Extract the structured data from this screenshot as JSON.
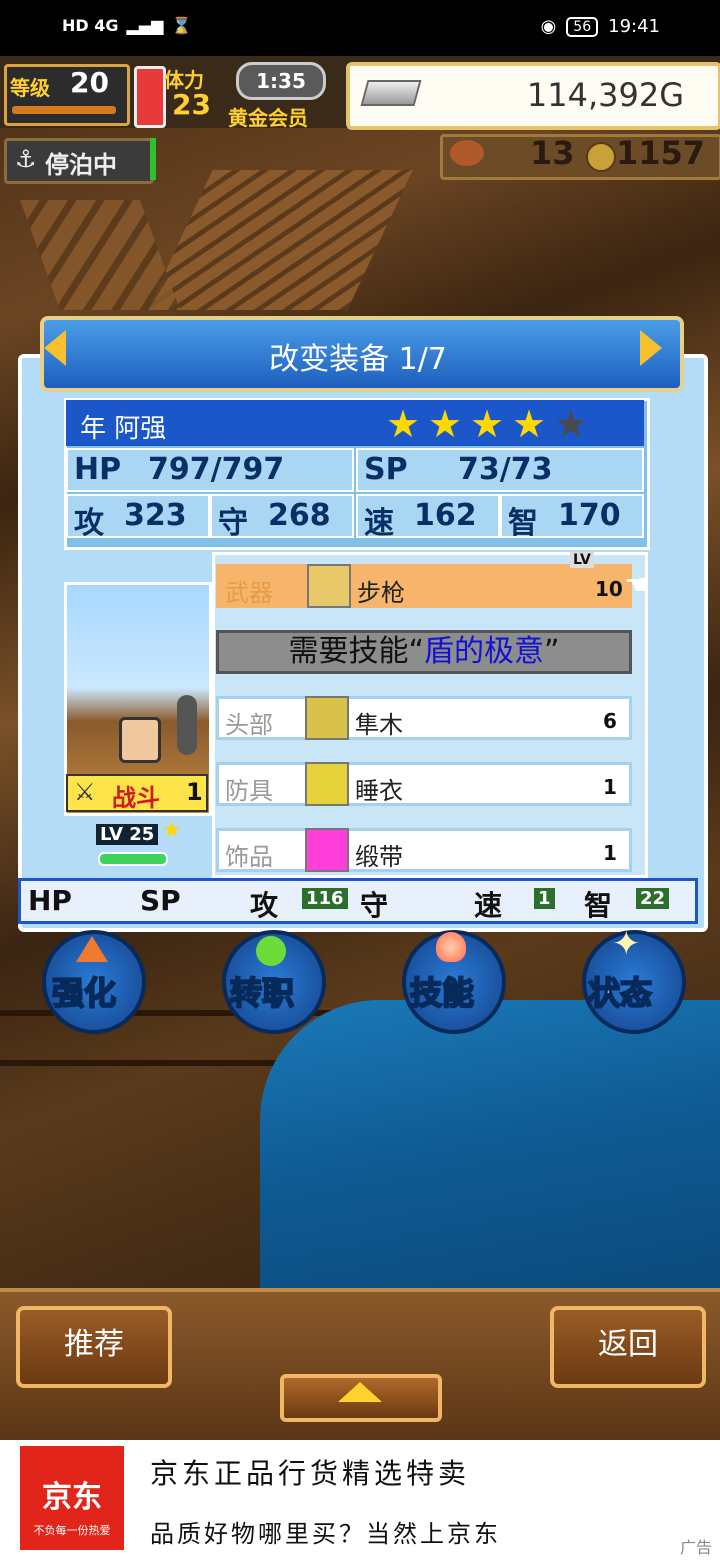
{
  "status_bar": {
    "left": "HD 4G",
    "battery": "56",
    "time": "19:41"
  },
  "hud": {
    "level_label": "等级",
    "level": "20",
    "stamina_label": "体力",
    "stamina": "23",
    "timer": "1:35",
    "membership": "黄金会员",
    "gold": "114,392G",
    "status": "停泊中",
    "resource_a": "13",
    "resource_b": "1157"
  },
  "dialog": {
    "title": "改变装备 1/7",
    "character_name": "年 阿强",
    "stars_filled": 4,
    "stars_total": 5,
    "stats": {
      "hp_label": "HP",
      "hp": "797/797",
      "sp_label": "SP",
      "sp": "73/73",
      "atk_label": "攻",
      "atk": "323",
      "def_label": "守",
      "def": "268",
      "spd_label": "速",
      "spd": "162",
      "int_label": "智",
      "int": "170"
    },
    "portrait": {
      "badge": "战斗",
      "badge_level": "1",
      "level_tag": "LV 25"
    },
    "weapon": {
      "slot": "武器",
      "name": "步枪",
      "level_label": "LV",
      "level": "10"
    },
    "skill_requirement": {
      "prefix": "需要技能“",
      "skill": "盾的极意",
      "suffix": "”"
    },
    "equipment": [
      {
        "slot": "头部",
        "name": "隼木",
        "count": "6",
        "icon_color": "#d9c24a"
      },
      {
        "slot": "防具",
        "name": "睡衣",
        "count": "1",
        "icon_color": "#e6d23a"
      },
      {
        "slot": "饰品",
        "name": "缎带",
        "count": "1",
        "icon_color": "#ff3fd9"
      }
    ],
    "diff_row": {
      "hp": "HP",
      "sp": "SP",
      "atk": "攻",
      "atk_val": "116",
      "def": "守",
      "spd": "速",
      "spd_val": "1",
      "int": "智",
      "int_val": "22"
    }
  },
  "actions": [
    {
      "label": "强化",
      "icon": "up-arrow-icon"
    },
    {
      "label": "转职",
      "icon": "gem-icon"
    },
    {
      "label": "技能",
      "icon": "flame-icon"
    },
    {
      "label": "状态",
      "icon": "sparkle-icon"
    }
  ],
  "bottom": {
    "recommend": "推荐",
    "back": "返回"
  },
  "ad": {
    "logo": "京东",
    "logo_sub": "不负每一份热爱",
    "line1": "京东正品行货精选特卖",
    "line2": "品质好物哪里买？当然上京东",
    "mark": "广告"
  }
}
